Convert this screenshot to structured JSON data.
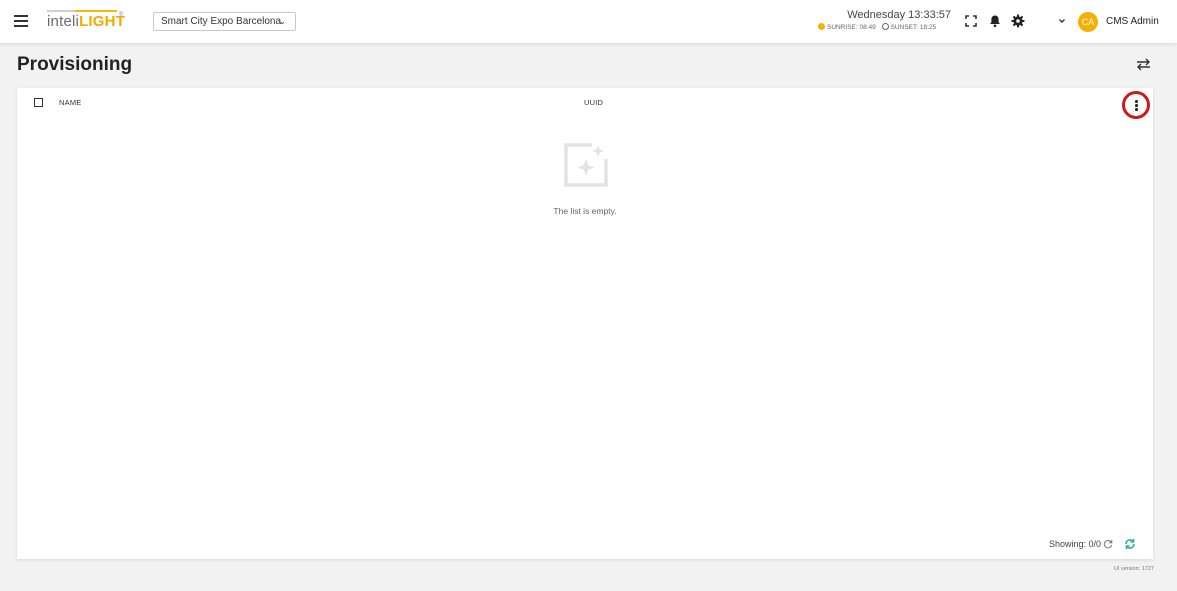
{
  "header": {
    "logo_part1": "inteli",
    "logo_part2": "LIGHT",
    "logo_reg": "®",
    "site": "Smart City Expo Barcelona",
    "datetime": "Wednesday 13:33:57",
    "sunrise": "SUNRISE: 08:49",
    "sunset": "SUNSET: 18:25",
    "avatar_initials": "CA",
    "user_name": "CMS Admin"
  },
  "page": {
    "title": "Provisioning"
  },
  "table": {
    "columns": [
      "NAME",
      "UUID"
    ],
    "empty_text": "The list is empty.",
    "showing": "Showing: 0/0"
  },
  "footer": {
    "version": "UI version: 1727"
  },
  "colors": {
    "accent": "#f6b100",
    "highlight": "#d01818",
    "refresh": "#2bb3a3"
  }
}
